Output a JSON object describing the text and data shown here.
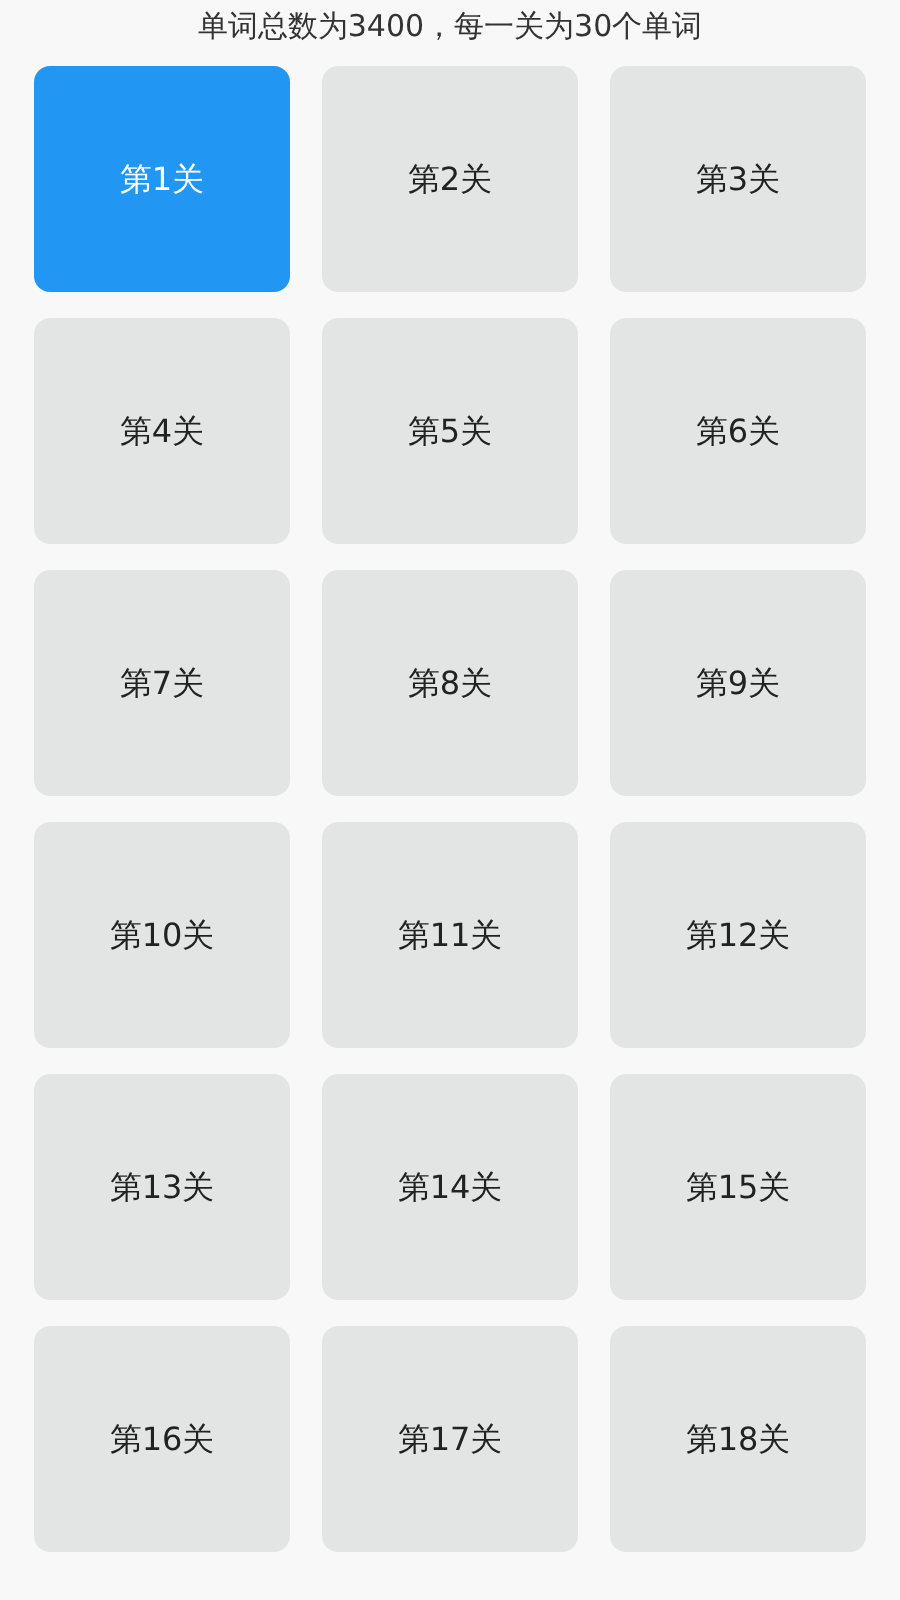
{
  "header_text": "单词总数为3400，每一关为30个单词",
  "levels": [
    {
      "label": "第1关",
      "selected": true
    },
    {
      "label": "第2关",
      "selected": false
    },
    {
      "label": "第3关",
      "selected": false
    },
    {
      "label": "第4关",
      "selected": false
    },
    {
      "label": "第5关",
      "selected": false
    },
    {
      "label": "第6关",
      "selected": false
    },
    {
      "label": "第7关",
      "selected": false
    },
    {
      "label": "第8关",
      "selected": false
    },
    {
      "label": "第9关",
      "selected": false
    },
    {
      "label": "第10关",
      "selected": false
    },
    {
      "label": "第11关",
      "selected": false
    },
    {
      "label": "第12关",
      "selected": false
    },
    {
      "label": "第13关",
      "selected": false
    },
    {
      "label": "第14关",
      "selected": false
    },
    {
      "label": "第15关",
      "selected": false
    },
    {
      "label": "第16关",
      "selected": false
    },
    {
      "label": "第17关",
      "selected": false
    },
    {
      "label": "第18关",
      "selected": false
    }
  ]
}
